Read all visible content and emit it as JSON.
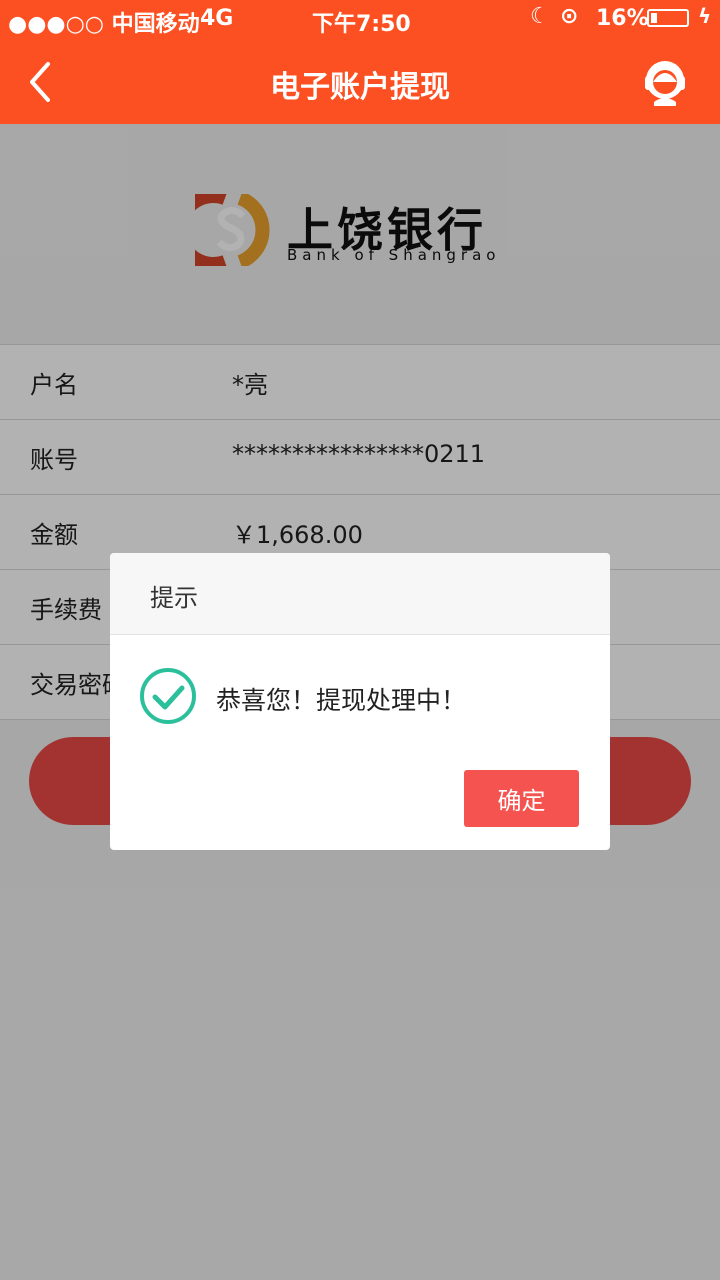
{
  "status": {
    "carrier": "●●●○○ 中国移动",
    "network": "4G",
    "time": "下午7:50",
    "battery": "16%"
  },
  "nav": {
    "title": "电子账户提现"
  },
  "bank": {
    "name_cn": "上饶银行",
    "name_en": "Bank of Shangrao"
  },
  "form": {
    "rows": [
      {
        "label": "户名",
        "value": "*亮"
      },
      {
        "label": "账号",
        "value": "****************0211"
      },
      {
        "label": "金额",
        "value": "￥1,668.00"
      },
      {
        "label": "手续费",
        "value": ""
      },
      {
        "label": "交易密码",
        "value": ""
      }
    ]
  },
  "dialog": {
    "title": "提示",
    "message": "恭喜您！提现处理中！",
    "confirm": "确定"
  },
  "colors": {
    "brand": "#fd5022",
    "button": "#f45350",
    "check": "#2bbf9c"
  }
}
